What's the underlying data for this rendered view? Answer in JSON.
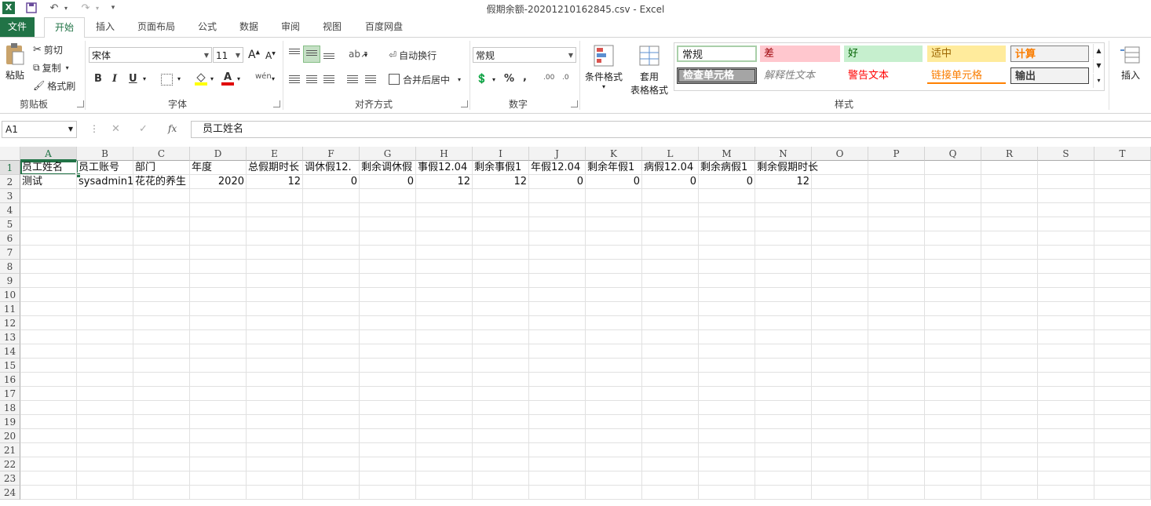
{
  "window": {
    "title": "假期余额-20201210162845.csv - Excel"
  },
  "quick_access": {
    "save": "save-icon",
    "undo": "↶",
    "redo": "↷",
    "customize": "▾"
  },
  "tabs": [
    "文件",
    "开始",
    "插入",
    "页面布局",
    "公式",
    "数据",
    "审阅",
    "视图",
    "百度网盘"
  ],
  "ribbon": {
    "clipboard": {
      "label": "剪贴板",
      "paste": "粘贴",
      "cut": "剪切",
      "copy": "复制",
      "format_painter": "格式刷"
    },
    "font": {
      "label": "字体",
      "font_name": "宋体",
      "font_size": "11",
      "bold": "B",
      "italic": "I",
      "underline": "U"
    },
    "alignment": {
      "label": "对齐方式",
      "wrap_text": "自动换行",
      "merge_center": "合并后居中"
    },
    "number": {
      "label": "数字",
      "format": "常规",
      "percent": "%",
      "comma": ",",
      "inc_decimal": ".00",
      "dec_decimal": ".0"
    },
    "styles": {
      "label": "样式",
      "conditional": "条件格式",
      "table_format_1": "套用",
      "table_format_2": "表格格式",
      "gallery": [
        "常规",
        "差",
        "好",
        "适中",
        "计算",
        "检查单元格",
        "解释性文本",
        "警告文本",
        "链接单元格",
        "输出"
      ]
    },
    "cells": {
      "insert": "插入"
    }
  },
  "formula_bar": {
    "name_box": "A1",
    "cancel": "✕",
    "enter": "✓",
    "fx": "fx",
    "content": "员工姓名"
  },
  "columns": [
    "A",
    "B",
    "C",
    "D",
    "E",
    "F",
    "G",
    "H",
    "I",
    "J",
    "K",
    "L",
    "M",
    "N",
    "O",
    "P",
    "Q",
    "R",
    "S",
    "T"
  ],
  "rows": [
    "1",
    "2",
    "3",
    "4",
    "5",
    "6",
    "7",
    "8",
    "9",
    "10",
    "11",
    "12",
    "13",
    "14",
    "15",
    "16",
    "17",
    "18",
    "19",
    "20",
    "21",
    "22",
    "23",
    "24"
  ],
  "sheet": {
    "row1": [
      "员工姓名",
      "员工账号",
      "部门",
      "年度",
      "总假期时长",
      "调休假12.",
      "剩余调休假",
      "事假12.04",
      "剩余事假1",
      "年假12.04",
      "剩余年假1",
      "病假12.04",
      "剩余病假1",
      "剩余假期时长"
    ],
    "row2": [
      "测试",
      "sysadmin1",
      "花花的养生",
      "2020",
      "12",
      "0",
      "0",
      "12",
      "12",
      "0",
      "0",
      "0",
      "0",
      "12"
    ]
  }
}
